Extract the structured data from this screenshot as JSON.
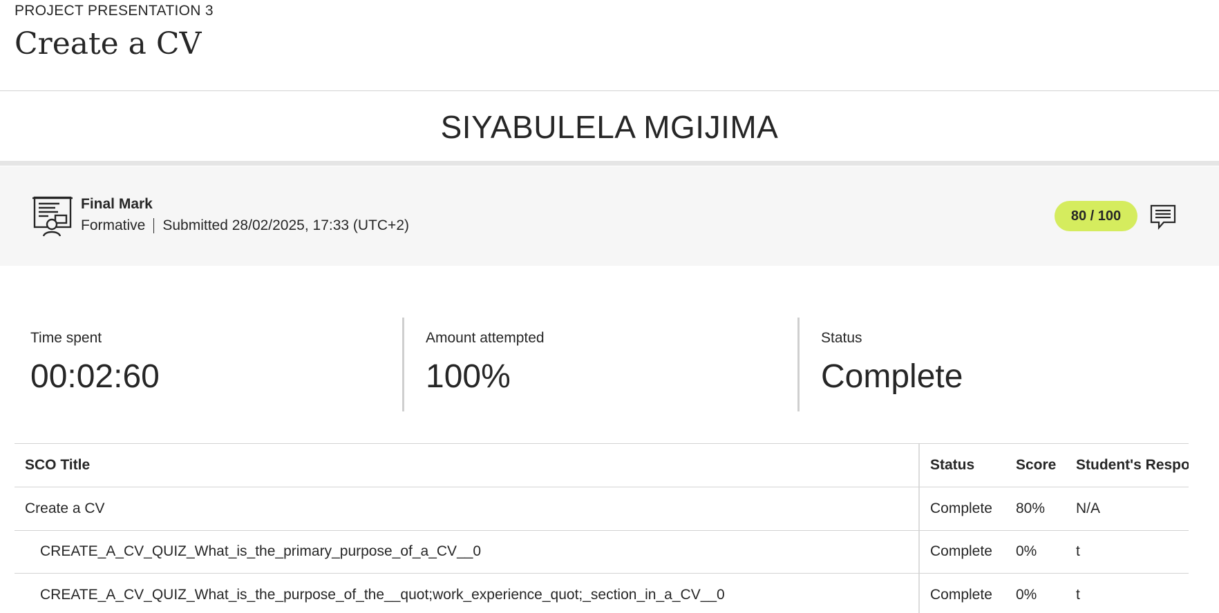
{
  "header": {
    "eyebrow": "PROJECT PRESENTATION 3",
    "title": "Create a CV"
  },
  "student": {
    "name": "SIYABULELA MGIJIMA"
  },
  "final_mark": {
    "icon": "certificate-icon",
    "label": "Final Mark",
    "type": "Formative",
    "submitted": "Submitted 28/02/2025, 17:33 (UTC+2)",
    "score": "80 / 100",
    "score_color": "#d5ec5e",
    "feedback_icon": "comment-icon"
  },
  "stats": [
    {
      "label": "Time spent",
      "value": "00:02:60"
    },
    {
      "label": "Amount attempted",
      "value": "100%"
    },
    {
      "label": "Status",
      "value": "Complete"
    }
  ],
  "table": {
    "columns": [
      "SCO Title",
      "Status",
      "Score",
      "Student's Respo"
    ],
    "rows": [
      {
        "title": "Create a CV",
        "status": "Complete",
        "score": "80%",
        "response": "N/A"
      },
      {
        "title": "CREATE_A_CV_QUIZ_What_is_the_primary_purpose_of_a_CV__0",
        "status": "Complete",
        "score": "0%",
        "response": "t"
      },
      {
        "title": "CREATE_A_CV_QUIZ_What_is_the_purpose_of_the__quot;work_experience_quot;_section_in_a_CV__0",
        "status": "Complete",
        "score": "0%",
        "response": "t"
      }
    ]
  }
}
